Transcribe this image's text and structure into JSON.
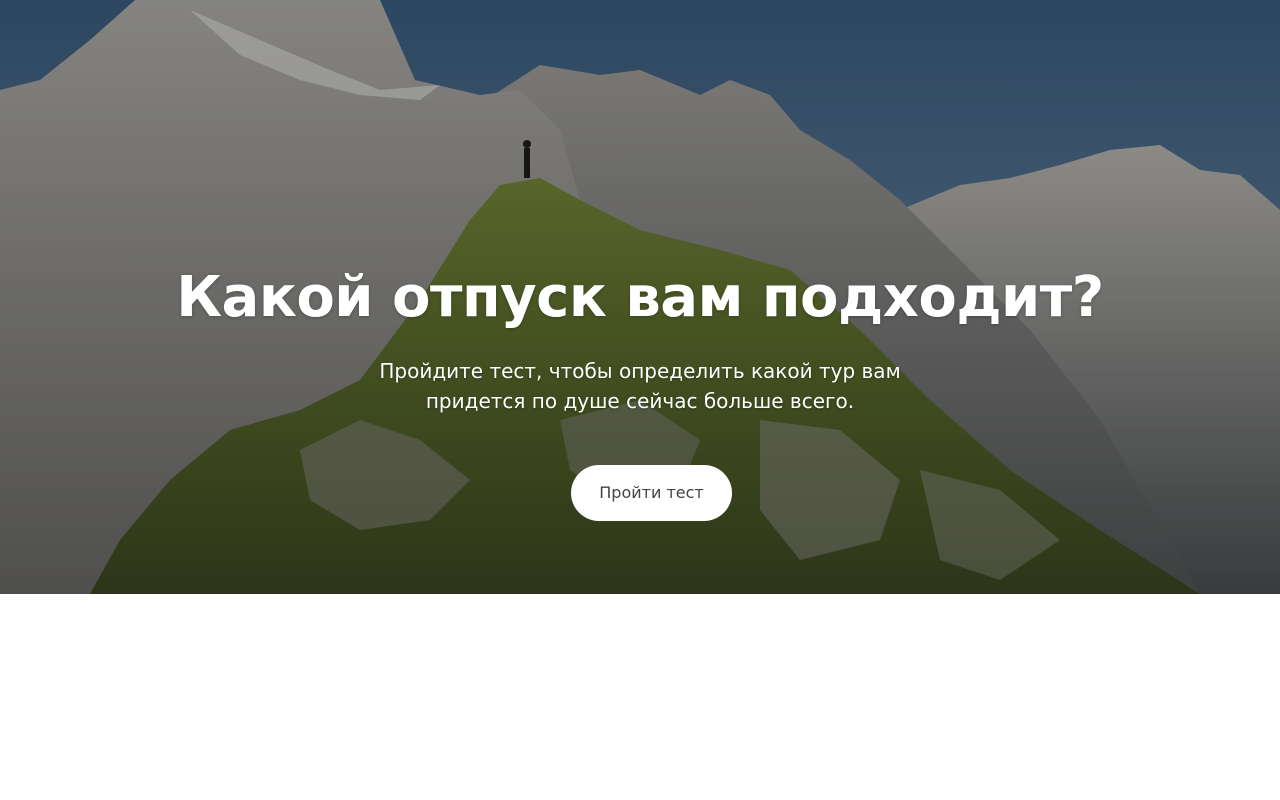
{
  "hero": {
    "title": "Какой отпуск вам подходит?",
    "subtitle": "Пройдите тест, чтобы определить какой тур вам придется по душе сейчас больше всего.",
    "button_label": "Пройти тест",
    "background_image": "mountain-landscape-photo"
  },
  "colors": {
    "sky": "#4f6e8c",
    "rock": "#9a9a98",
    "grass": "#5d7a2e",
    "button_bg": "#ffffff",
    "button_text": "#444444",
    "title_text": "#ffffff"
  }
}
